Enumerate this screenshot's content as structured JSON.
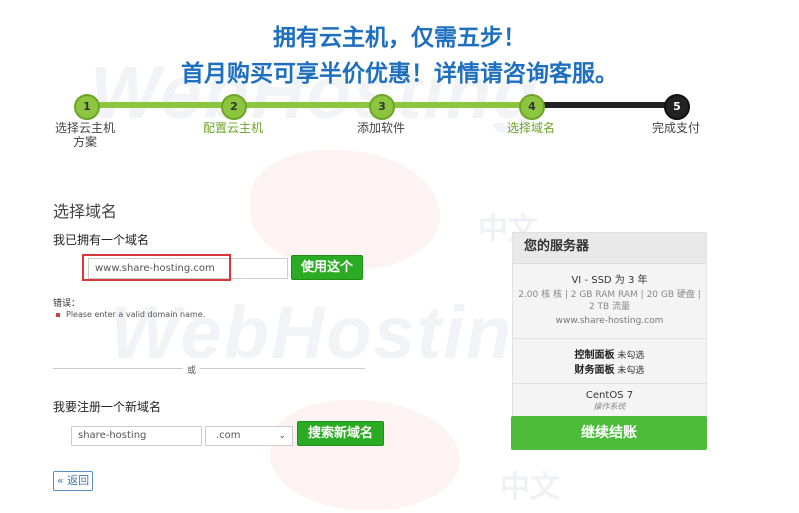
{
  "headline": {
    "line1": "拥有云主机，仅需五步！",
    "line2": "首月购买可享半价优惠！详情请咨询客服。"
  },
  "steps": [
    {
      "number": "1",
      "label": "选择云主机方案",
      "state": "done"
    },
    {
      "number": "2",
      "label": "配置云主机",
      "state": "done"
    },
    {
      "number": "3",
      "label": "添加软件",
      "state": "done"
    },
    {
      "number": "4",
      "label": "选择域名",
      "state": "current"
    },
    {
      "number": "5",
      "label": "完成支付",
      "state": "todo"
    }
  ],
  "domain_section": {
    "title": "选择域名",
    "own_label": "我已拥有一个域名",
    "own_value": "www.share-hosting.com",
    "use_button": "使用这个",
    "error_label": "错误：",
    "error_message": "Please enter a valid domain name.",
    "or_text": "或",
    "register_label": "我要注册一个新域名",
    "register_value": "share-hosting",
    "tld_selected": ".com",
    "search_button": "搜索新域名",
    "back_button": "« 返回"
  },
  "server_panel": {
    "title": "您的服务器",
    "plan_name": "VI - SSD 为 3 年",
    "plan_specs": "2.00 核 核 | 2 GB RAM RAM | 20 GB 硬盘 | 2 TB 流量",
    "hostname": "www.share-hosting.com",
    "control_panel_label": "控制面板",
    "control_panel_value": "未勾选",
    "billing_panel_label": "财务面板",
    "billing_panel_value": "未勾选",
    "os_name": "CentOS 7",
    "os_label": "操作系统",
    "checkout_button": "继续结账"
  },
  "watermark": {
    "text": "WebHosting",
    "zh": "中文"
  },
  "colors": {
    "headline_blue": "#1f6fbf",
    "step_green": "#8cc63f",
    "button_green": "#2bab24",
    "error_red": "#d9383a"
  }
}
